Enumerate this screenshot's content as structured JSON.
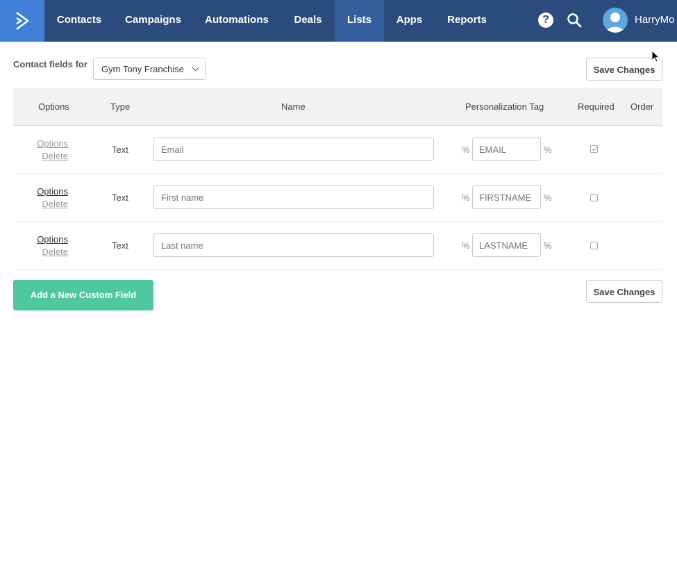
{
  "nav": {
    "items": [
      {
        "label": "Contacts"
      },
      {
        "label": "Campaigns"
      },
      {
        "label": "Automations"
      },
      {
        "label": "Deals"
      },
      {
        "label": "Lists",
        "active": true
      },
      {
        "label": "Apps"
      },
      {
        "label": "Reports"
      }
    ],
    "help_icon": "?",
    "user_name": "HarryMo"
  },
  "header": {
    "contact_fields_label": "Contact fields for",
    "list_selected": "Gym Tony Franchise",
    "save_label": "Save Changes"
  },
  "table": {
    "columns": {
      "options": "Options",
      "type": "Type",
      "name": "Name",
      "personalization_tag": "Personalization Tag",
      "required": "Required",
      "order": "Order"
    },
    "rows": [
      {
        "options": "Options",
        "delete": "Delete",
        "type": "Text",
        "name_placeholder": "Email",
        "pct_left": "%",
        "tag": "EMAIL",
        "pct_right": "%",
        "required": true
      },
      {
        "options": "Options",
        "delete": "Delete",
        "type": "Text",
        "name_placeholder": "First name",
        "pct_left": "%",
        "tag": "FIRSTNAME",
        "pct_right": "%",
        "required": false
      },
      {
        "options": "Options",
        "delete": "Delete",
        "type": "Text",
        "name_placeholder": "Last name",
        "pct_left": "%",
        "tag": "LASTNAME",
        "pct_right": "%",
        "required": false
      }
    ]
  },
  "footer": {
    "add_field_label": "Add a New Custom Field",
    "save_label": "Save Changes"
  },
  "colors": {
    "nav_bg": "#2b4b7c",
    "nav_active": "#33609c",
    "logo_bg": "#3f7fd8",
    "add_button": "#4fc8a2"
  }
}
